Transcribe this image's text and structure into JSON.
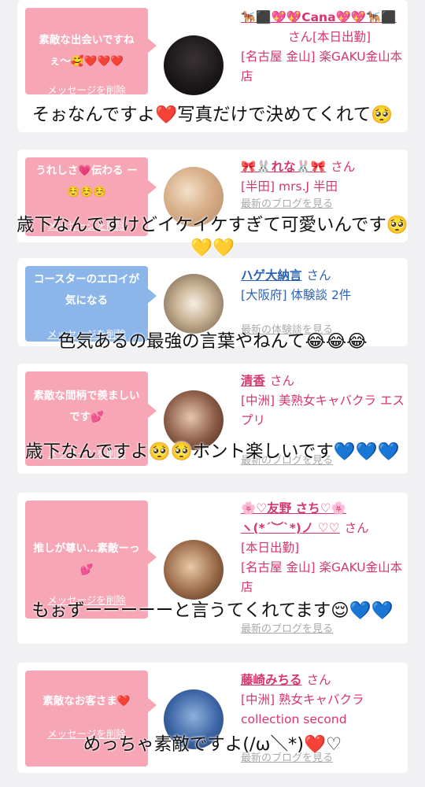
{
  "items": [
    {
      "bubble": "素敵な出会いですねぇ〜🥰❤️❤️❤️",
      "bubble_color": "#f7a6b6",
      "delete_label": "メッセージを削除",
      "name": "🐕‍🦺⬛💖💖Cana💖💖🐕‍🦺⬛",
      "san": "さん[本日出勤]",
      "shop": "[名古屋 金山] 楽GAKU金山本店",
      "latest": "",
      "overlay": "そぉなんですよ❤️写真だけで決めてくれて🥺"
    },
    {
      "bubble": "うれしさ💗伝わる ー☺️☺️☺️",
      "bubble_color": "#f7a6b6",
      "delete_label": "メッセージを削除",
      "name": "🎀🐰れな🐰🎀",
      "san": "さん",
      "shop": "[半田] mrs.J 半田",
      "latest": "最新のブログを見る",
      "overlay": "歳下なんですけどイケイケすぎて可愛いんです🥺💛💛"
    },
    {
      "bubble": "コースターのエロイが気になる",
      "bubble_color": "#8cb6ea",
      "delete_label": "メッセージを削除",
      "name": "ハゲ大納言",
      "san": "さん",
      "shop": "[大阪府] 体験談 2件",
      "latest": "最新の体験談を見る",
      "overlay": "色気あるの最強の言葉やねんて😂😂😂"
    },
    {
      "bubble": "素敵な間柄で羨ましいです💕",
      "bubble_color": "#f7a6b6",
      "delete_label": "メッセージを削除",
      "name": "清香",
      "san": "さん",
      "shop": "[中洲] 美熟女キャバクラ エスプリ",
      "latest": "最新のブログを見る",
      "overlay": "歳下なんですよ🥺🥺ホント楽しいです💙💙💙"
    },
    {
      "bubble": "推しが尊い…素敵ーっ💕",
      "bubble_color": "#f7a6b6",
      "delete_label": "メッセージを削除",
      "name": "🌸♡友野 さち♡🌸",
      "san": "さん",
      "name2": "ヽ(*´︶`*)ノ ♡♡",
      "status": "[本日出勤]",
      "shop": "[名古屋 金山] 楽GAKU金山本店",
      "latest": "最新のブログを見る",
      "overlay": "もぉずーーーーーと言うてくれてます😌💙💙"
    },
    {
      "bubble": "素敵なお客さま❤️",
      "bubble_color": "#f7a6b6",
      "delete_label": "メッセージを削除",
      "name": "藤崎みちる",
      "san": "さん",
      "shop": "[中洲] 熟女キャバクラ collection second",
      "latest": "最新のブログを見る",
      "overlay": "めっちゃ素敵ですよ(/ω＼*)❤️♡"
    }
  ]
}
